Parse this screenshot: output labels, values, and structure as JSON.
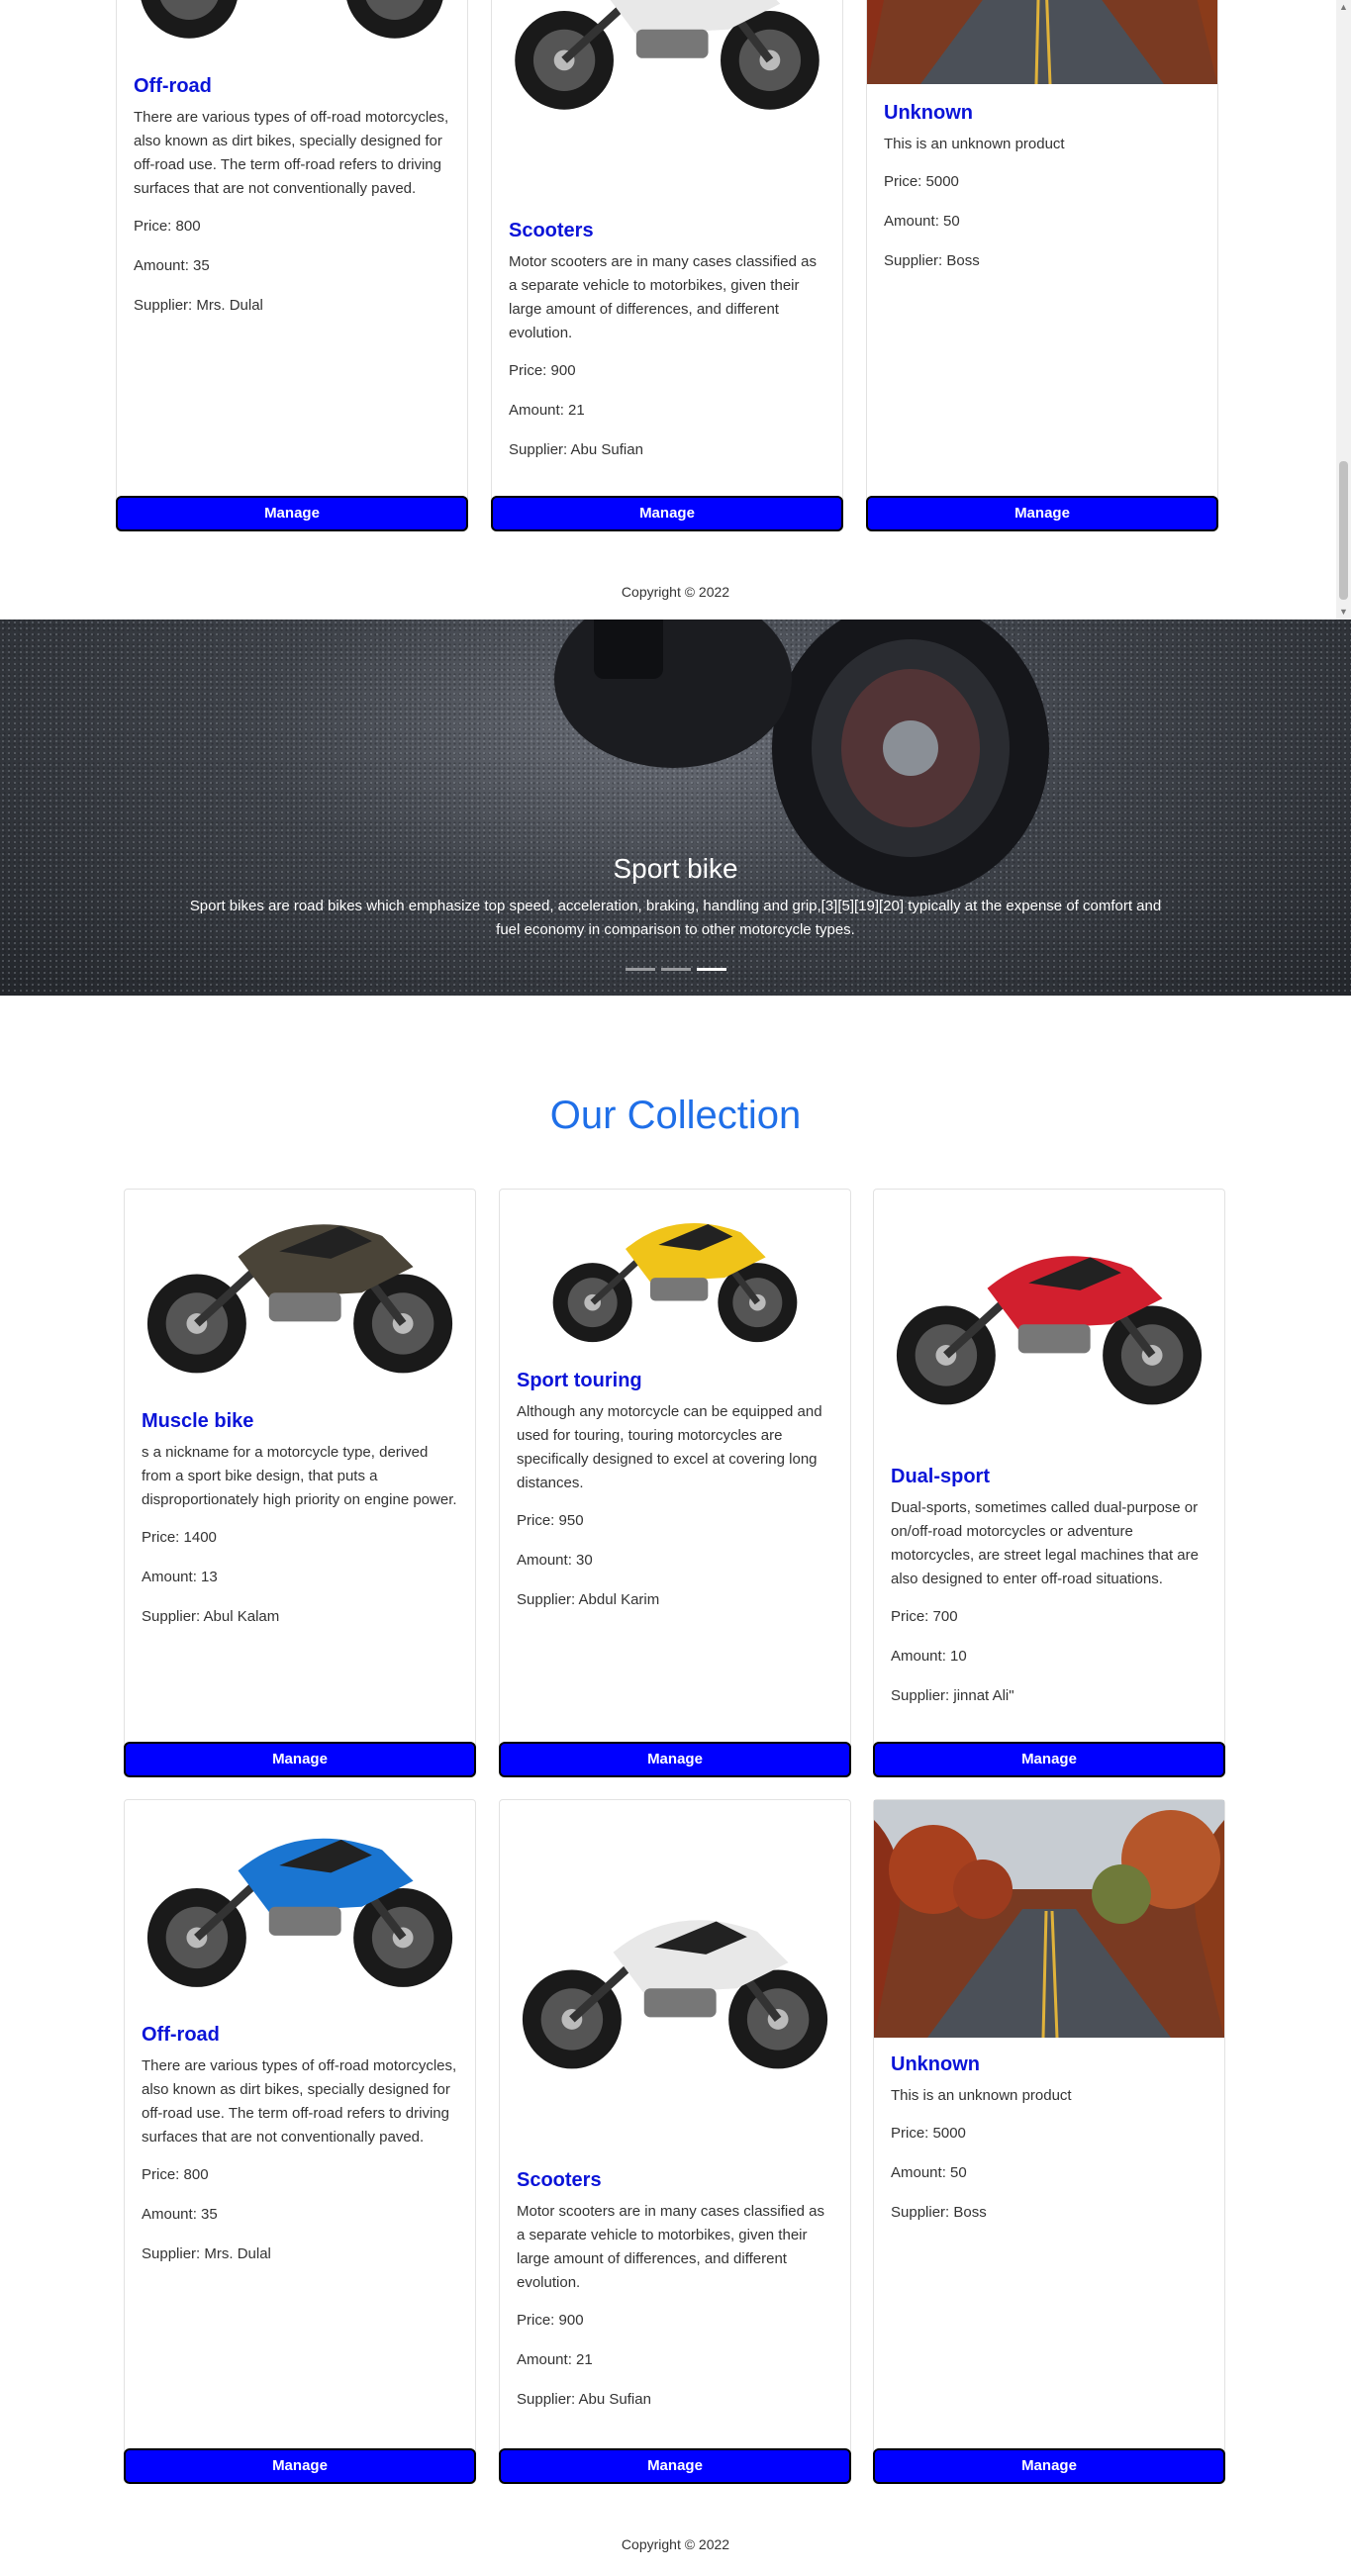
{
  "top_frame": {
    "cards": [
      {
        "title": "Off-road",
        "desc": "There are various types of off-road motorcycles, also known as dirt bikes, specially designed for off-road use. The term off-road refers to driving surfaces that are not conventionally paved.",
        "price": "Price: 800",
        "amount": "Amount: 35",
        "supplier": "Supplier: Mrs. Dulal",
        "button": "Manage"
      },
      {
        "title": "Scooters",
        "desc": "Motor scooters are in many cases classified as a separate vehicle to motorbikes, given their large amount of differences, and different evolution.",
        "price": "Price: 900",
        "amount": "Amount: 21",
        "supplier": "Supplier: Abu Sufian",
        "button": "Manage"
      },
      {
        "title": "Unknown",
        "desc": "This is an unknown product",
        "price": "Price: 5000",
        "amount": "Amount: 50",
        "supplier": "Supplier: Boss",
        "button": "Manage"
      }
    ],
    "copyright": "Copyright © 2022"
  },
  "hero": {
    "title": "Sport bike",
    "caption": "Sport bikes are road bikes which emphasize top speed, acceleration, braking, handling and grip,[3][5][19][20] typically at the expense of comfort and fuel economy in comparison to other motorcycle types.",
    "slides": 3,
    "active_slide": 3
  },
  "collection": {
    "heading": "Our Collection",
    "cards": [
      {
        "title": "Muscle bike",
        "desc": "s a nickname for a motorcycle type, derived from a sport bike design, that puts a disproportionately high priority on engine power.",
        "price": "Price: 1400",
        "amount": "Amount: 13",
        "supplier": "Supplier: Abul Kalam",
        "button": "Manage"
      },
      {
        "title": "Sport touring",
        "desc": "Although any motorcycle can be equipped and used for touring, touring motorcycles are specifically designed to excel at covering long distances.",
        "price": "Price: 950",
        "amount": "Amount: 30",
        "supplier": "Supplier: Abdul Karim",
        "button": "Manage"
      },
      {
        "title": "Dual-sport",
        "desc": "Dual-sports, sometimes called dual-purpose or on/off-road motorcycles or adventure motorcycles, are street legal machines that are also designed to enter off-road situations.",
        "price": "Price: 700",
        "amount": "Amount: 10",
        "supplier": "Supplier: jinnat Ali\"",
        "button": "Manage"
      },
      {
        "title": "Off-road",
        "desc": "There are various types of off-road motorcycles, also known as dirt bikes, specially designed for off-road use. The term off-road refers to driving surfaces that are not conventionally paved.",
        "price": "Price: 800",
        "amount": "Amount: 35",
        "supplier": "Supplier: Mrs. Dulal",
        "button": "Manage"
      },
      {
        "title": "Scooters",
        "desc": "Motor scooters are in many cases classified as a separate vehicle to motorbikes, given their large amount of differences, and different evolution.",
        "price": "Price: 900",
        "amount": "Amount: 21",
        "supplier": "Supplier: Abu Sufian",
        "button": "Manage"
      },
      {
        "title": "Unknown",
        "desc": "This is an unknown product",
        "price": "Price: 5000",
        "amount": "Amount: 50",
        "supplier": "Supplier: Boss",
        "button": "Manage"
      }
    ]
  },
  "footer": {
    "copyright": "Copyright © 2022"
  }
}
